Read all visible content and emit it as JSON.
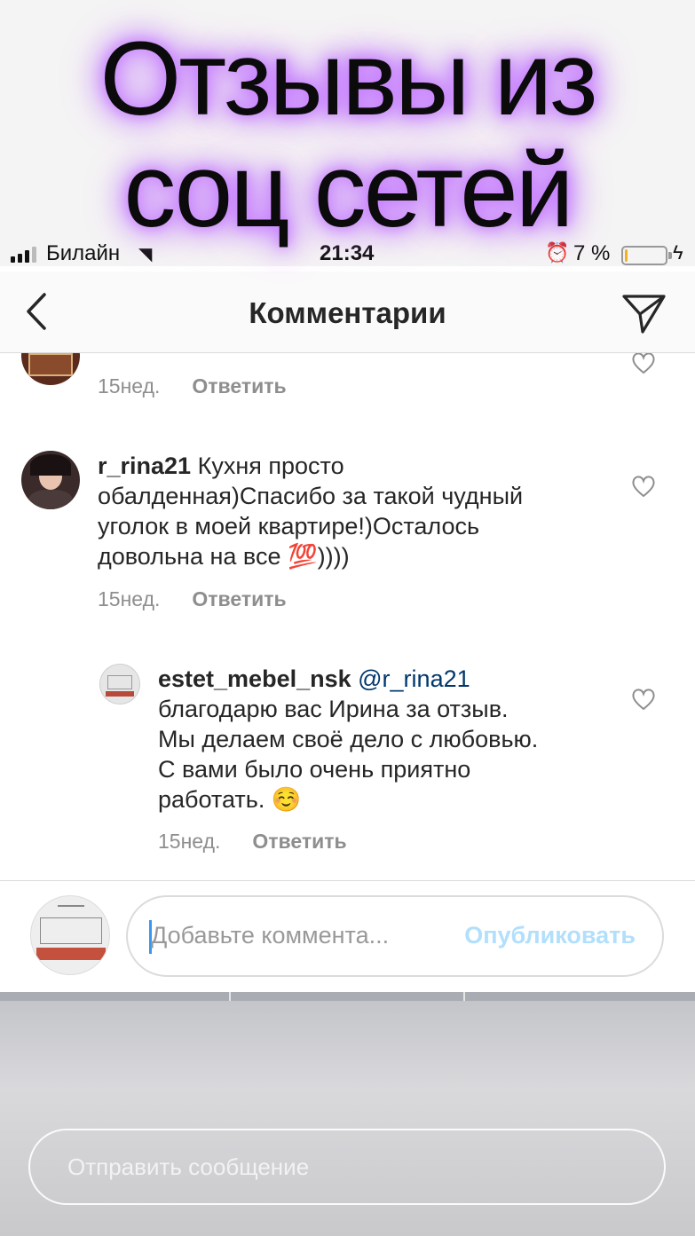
{
  "overlay": {
    "line1": "Отзывы из",
    "line2": "соц сетей"
  },
  "status_bar": {
    "carrier": "Билайн",
    "time": "21:34",
    "battery_text": "7 %",
    "battery_level": 0.07
  },
  "header": {
    "title": "Комментарии"
  },
  "comments": [
    {
      "time": "15нед.",
      "reply": "Ответить"
    },
    {
      "username": "r_rina21",
      "lines": [
        "Кухня просто",
        "обалденная)Спасибо за такой чудный",
        "уголок в моей квартире!)Осталось",
        "довольна на все"
      ],
      "emoji": "💯",
      "tail": "))))",
      "time": "15нед.",
      "reply": "Ответить"
    },
    {
      "username": "estet_mebel_nsk",
      "mention": "@r_rina21",
      "lines": [
        "благодарю вас Ирина за отзыв.",
        "Мы делаем своё дело с любовью.",
        "С вами было очень приятно",
        "работать."
      ],
      "emoji": "☺️",
      "time": "15нед.",
      "reply": "Ответить"
    }
  ],
  "comment_input": {
    "placeholder": "Добавьте коммента...",
    "publish": "Опубликовать"
  },
  "message_input": {
    "placeholder": "Отправить сообщение"
  },
  "colors": {
    "glow": "#c77dff",
    "link": "#00376b",
    "publish": "#b2dffc",
    "meta": "#8e8e8e"
  }
}
